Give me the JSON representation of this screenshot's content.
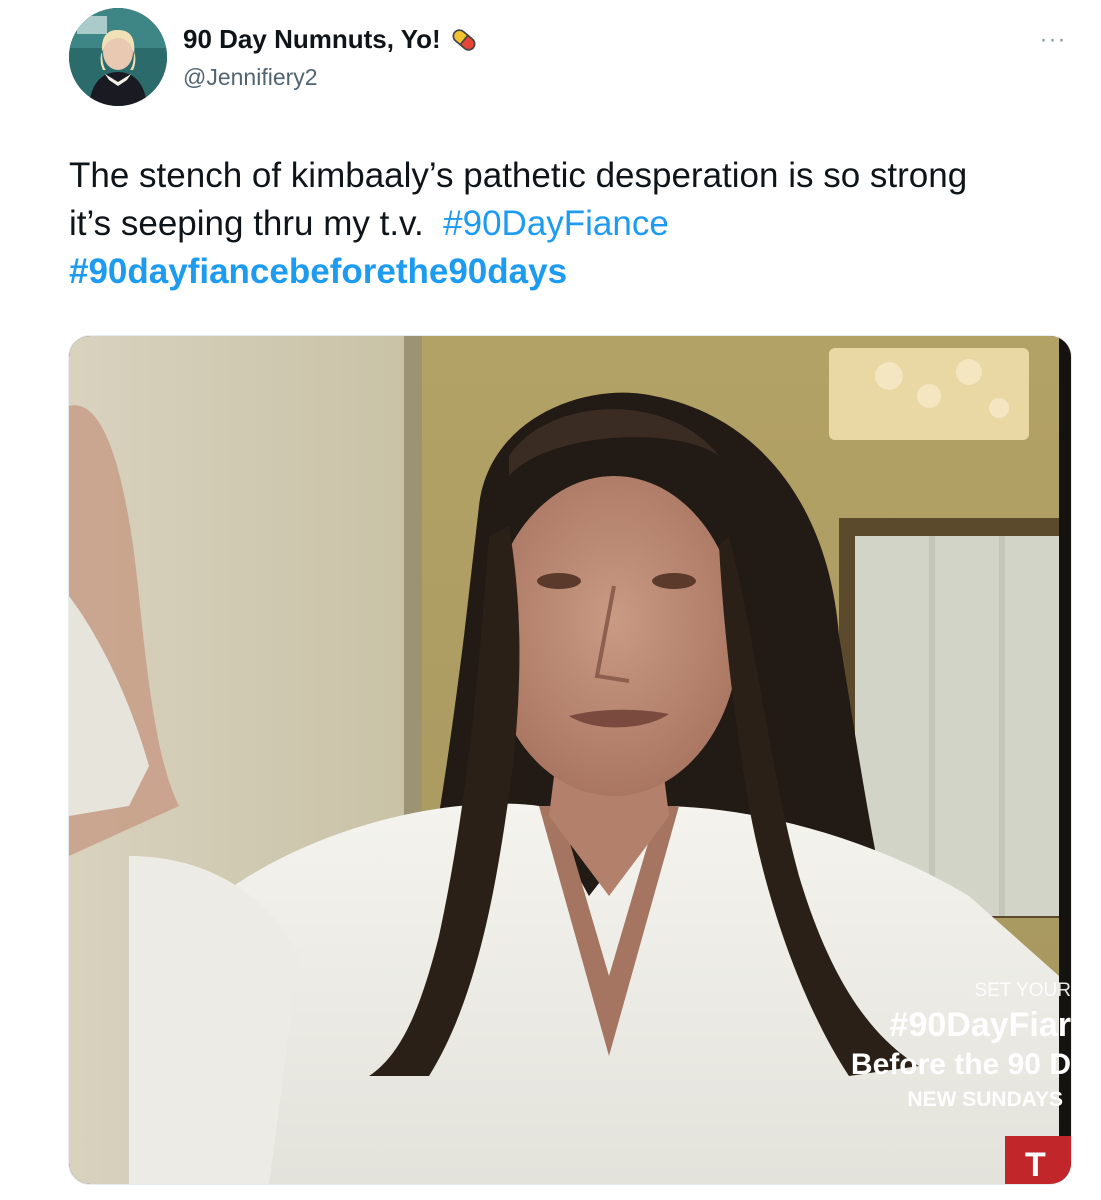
{
  "author": {
    "display_name": "90 Day Numnuts, Yo!",
    "handle": "@Jennifiery2",
    "badge_icon": "pill-icon",
    "avatar_icon": "avatar"
  },
  "menu": {
    "more_label": "···",
    "more_icon": "more-icon"
  },
  "tweet": {
    "text_part1": "The stench of kimbaaly’s pathetic desperation is so strong",
    "text_part2": "it’s seeping thru my t.v.",
    "hashtag1": "#90DayFiance",
    "hashtag2": "#90dayfiancebeforethe90days"
  },
  "media": {
    "overlay": {
      "line1": "SET YOUR",
      "line2": "#90DayFiar",
      "line3": "Before the 90 D",
      "line4": "NEW SUNDAYS",
      "logo": "T"
    }
  },
  "colors": {
    "link": "#1d9bf0",
    "text": "#0f1419",
    "secondary": "#536471"
  }
}
